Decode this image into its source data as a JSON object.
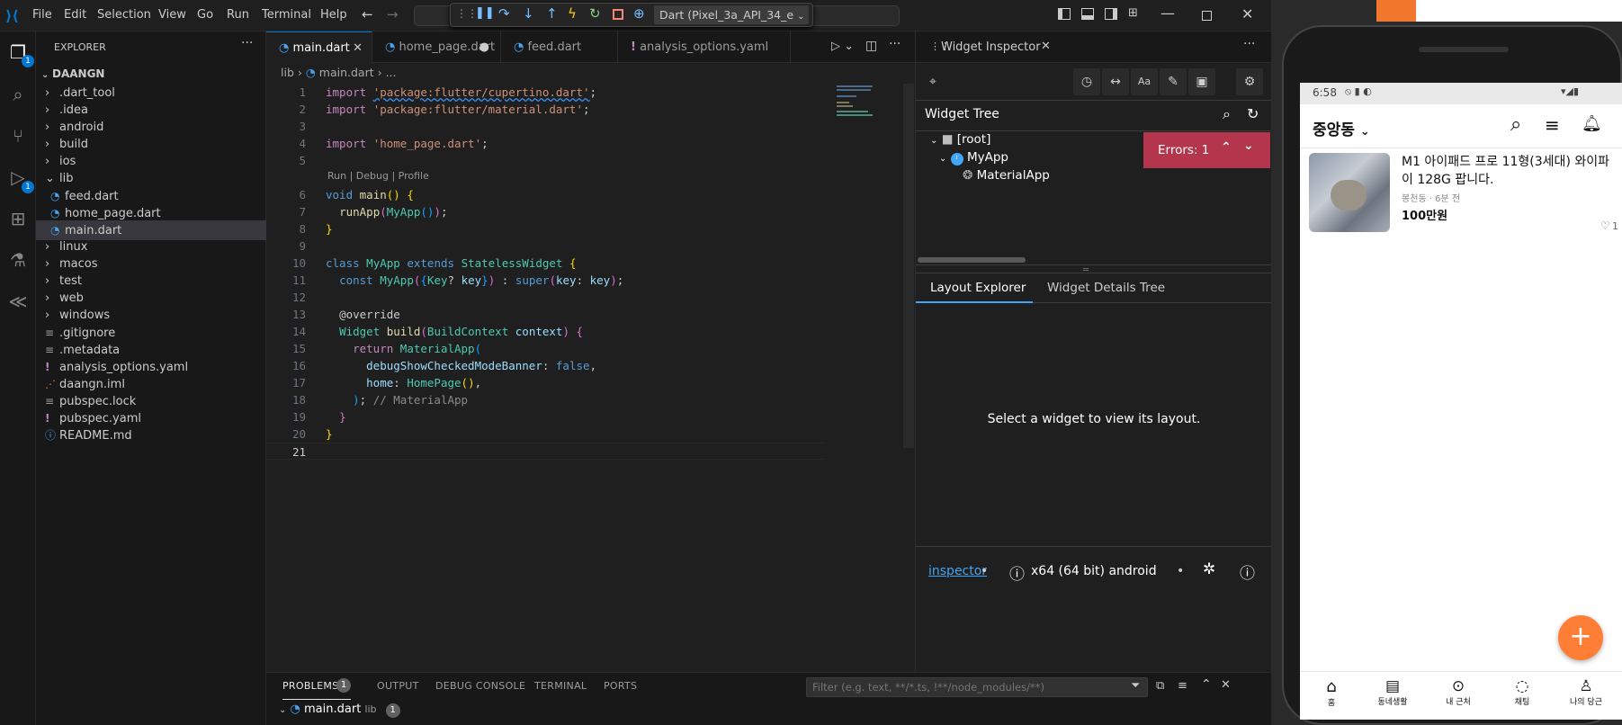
{
  "menu": [
    "File",
    "Edit",
    "Selection",
    "View",
    "Go",
    "Run",
    "Terminal",
    "Help"
  ],
  "debug_target": "Dart (Pixel_3a_API_34_e",
  "explorer": {
    "title": "EXPLORER",
    "project": "DAANGN",
    "items": [
      {
        "label": ".dart_tool",
        "type": "folder"
      },
      {
        "label": ".idea",
        "type": "folder"
      },
      {
        "label": "android",
        "type": "folder"
      },
      {
        "label": "build",
        "type": "folder"
      },
      {
        "label": "ios",
        "type": "folder"
      },
      {
        "label": "lib",
        "type": "folder-open"
      },
      {
        "label": "feed.dart",
        "type": "dart"
      },
      {
        "label": "home_page.dart",
        "type": "dart"
      },
      {
        "label": "main.dart",
        "type": "dart"
      },
      {
        "label": "linux",
        "type": "folder"
      },
      {
        "label": "macos",
        "type": "folder"
      },
      {
        "label": "test",
        "type": "folder"
      },
      {
        "label": "web",
        "type": "folder"
      },
      {
        "label": "windows",
        "type": "folder"
      },
      {
        "label": ".gitignore",
        "type": "file"
      },
      {
        "label": ".metadata",
        "type": "file"
      },
      {
        "label": "analysis_options.yaml",
        "type": "yaml"
      },
      {
        "label": "daangn.iml",
        "type": "xml"
      },
      {
        "label": "pubspec.lock",
        "type": "file"
      },
      {
        "label": "pubspec.yaml",
        "type": "yaml"
      },
      {
        "label": "README.md",
        "type": "info"
      }
    ]
  },
  "tabs": [
    {
      "label": "main.dart",
      "active": true
    },
    {
      "label": "home_page.dart",
      "active": false
    },
    {
      "label": "feed.dart",
      "active": false
    },
    {
      "label": "analysis_options.yaml",
      "active": false
    }
  ],
  "breadcrumb": [
    "lib",
    "main.dart",
    "..."
  ],
  "codelens": "Run | Debug | Profile",
  "code": [
    "import 'package:flutter/cupertino.dart';",
    "import 'package:flutter/material.dart';",
    "",
    "import 'home_page.dart';",
    "",
    "void main() {",
    "  runApp(MyApp());",
    "}",
    "",
    "class MyApp extends StatelessWidget {",
    "  const MyApp({Key? key}) : super(key: key);",
    "",
    "  @override",
    "  Widget build(BuildContext context) {",
    "    return MaterialApp(",
    "      debugShowCheckedModeBanner: false,",
    "      home: HomePage(),",
    "    ); // MaterialApp",
    "  }",
    "}",
    ""
  ],
  "panel": {
    "tabs": [
      "PROBLEMS",
      "OUTPUT",
      "DEBUG CONSOLE",
      "TERMINAL",
      "PORTS"
    ],
    "problems_count": "1",
    "filter_placeholder": "Filter (e.g. text, **/*.ts, !**/node_modules/**)",
    "problem_file": "main.dart",
    "problem_dir": "lib",
    "problem_file_count": "1"
  },
  "inspector": {
    "tab_title": "Widget Inspector",
    "tree_title": "Widget Tree",
    "root": "[root]",
    "myapp": "MyApp",
    "materialapp": "MaterialApp",
    "errors": "Errors: 1",
    "layout_tab": "Layout Explorer",
    "details_tab": "Widget Details Tree",
    "empty_msg": "Select a widget to view its layout.",
    "footer_link": "inspector",
    "footer_platform": "x64 (64 bit) android"
  },
  "phone": {
    "time": "6:58",
    "location": "중앙동",
    "item_title": "M1 아이패드 프로 11형(3세대) 와이파이 128G 팝니다.",
    "item_meta": "봉천동 · 6분 전",
    "item_price": "100만원",
    "item_likes": "1",
    "nav": [
      "홈",
      "동네생활",
      "내 근처",
      "채팅",
      "나의 당근"
    ]
  },
  "colors": {
    "accent": "#0078d4",
    "error": "#b3364c",
    "fab": "#ff7e36"
  }
}
